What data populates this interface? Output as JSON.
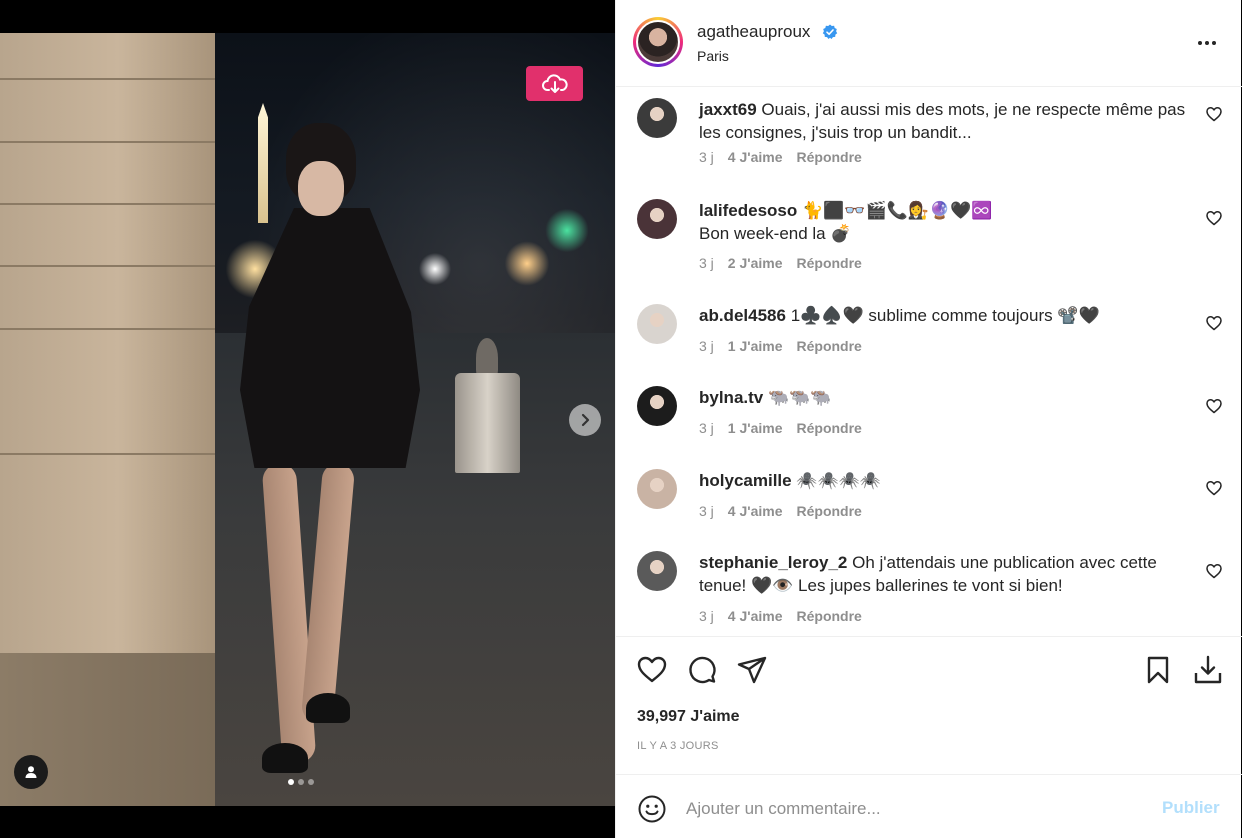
{
  "post": {
    "author": "agatheauproux",
    "location": "Paris",
    "verified": true,
    "likes": "39,997 J'aime",
    "timestamp": "IL Y A 3 JOURS",
    "carousel": {
      "slides": 3,
      "current": 1
    }
  },
  "comments": [
    {
      "user": "jaxxt69",
      "text": "Ouais, j'ai aussi mis des mots, je ne respecte même pas les consignes, j'suis trop un bandit...",
      "time": "3 j",
      "likes": "4 J'aime",
      "reply": "Répondre",
      "avatar_color": "#3b3b3b"
    },
    {
      "user": "lalifedesoso",
      "text": "🐈⬛👓🎬📞👩‍⚖️🔮🖤♾️",
      "text2": "Bon week-end la 💣",
      "time": "3 j",
      "likes": "2 J'aime",
      "reply": "Répondre",
      "avatar_color": "#4a3338"
    },
    {
      "user": "ab.del4586",
      "text": "1♣️♠️🖤 sublime comme toujours 📽️🖤",
      "time": "3 j",
      "likes": "1 J'aime",
      "reply": "Répondre",
      "avatar_color": "#d9d4cf"
    },
    {
      "user": "bylna.tv",
      "text": "🐃🐃🐃",
      "time": "3 j",
      "likes": "1 J'aime",
      "reply": "Répondre",
      "avatar_color": "#1c1c1c"
    },
    {
      "user": "holycamille",
      "text": "🕷️🕷️🕷️🕷️",
      "time": "3 j",
      "likes": "4 J'aime",
      "reply": "Répondre",
      "avatar_color": "#c9b3a4"
    },
    {
      "user": "stephanie_leroy_2",
      "text": "Oh j'attendais une publication avec cette tenue! 🖤👁️ Les jupes ballerines te vont si bien!",
      "time": "3 j",
      "likes": "4 J'aime",
      "reply": "Répondre",
      "avatar_color": "#5a5a5a"
    }
  ],
  "comment_box": {
    "placeholder": "Ajouter un commentaire...",
    "publish_label": "Publier"
  },
  "colors": {
    "download_badge": "#e1306c",
    "verified": "#3897f0",
    "publish_disabled": "#b2dffc"
  },
  "icons": {
    "download": "cloud-download-icon",
    "next": "chevron-right-icon",
    "tag": "user-tag-icon",
    "more": "more-horizontal-icon",
    "like": "heart-icon",
    "comment": "comment-icon",
    "share": "send-icon",
    "save": "bookmark-icon",
    "save_post": "download-tray-icon",
    "emoji": "emoji-icon"
  }
}
